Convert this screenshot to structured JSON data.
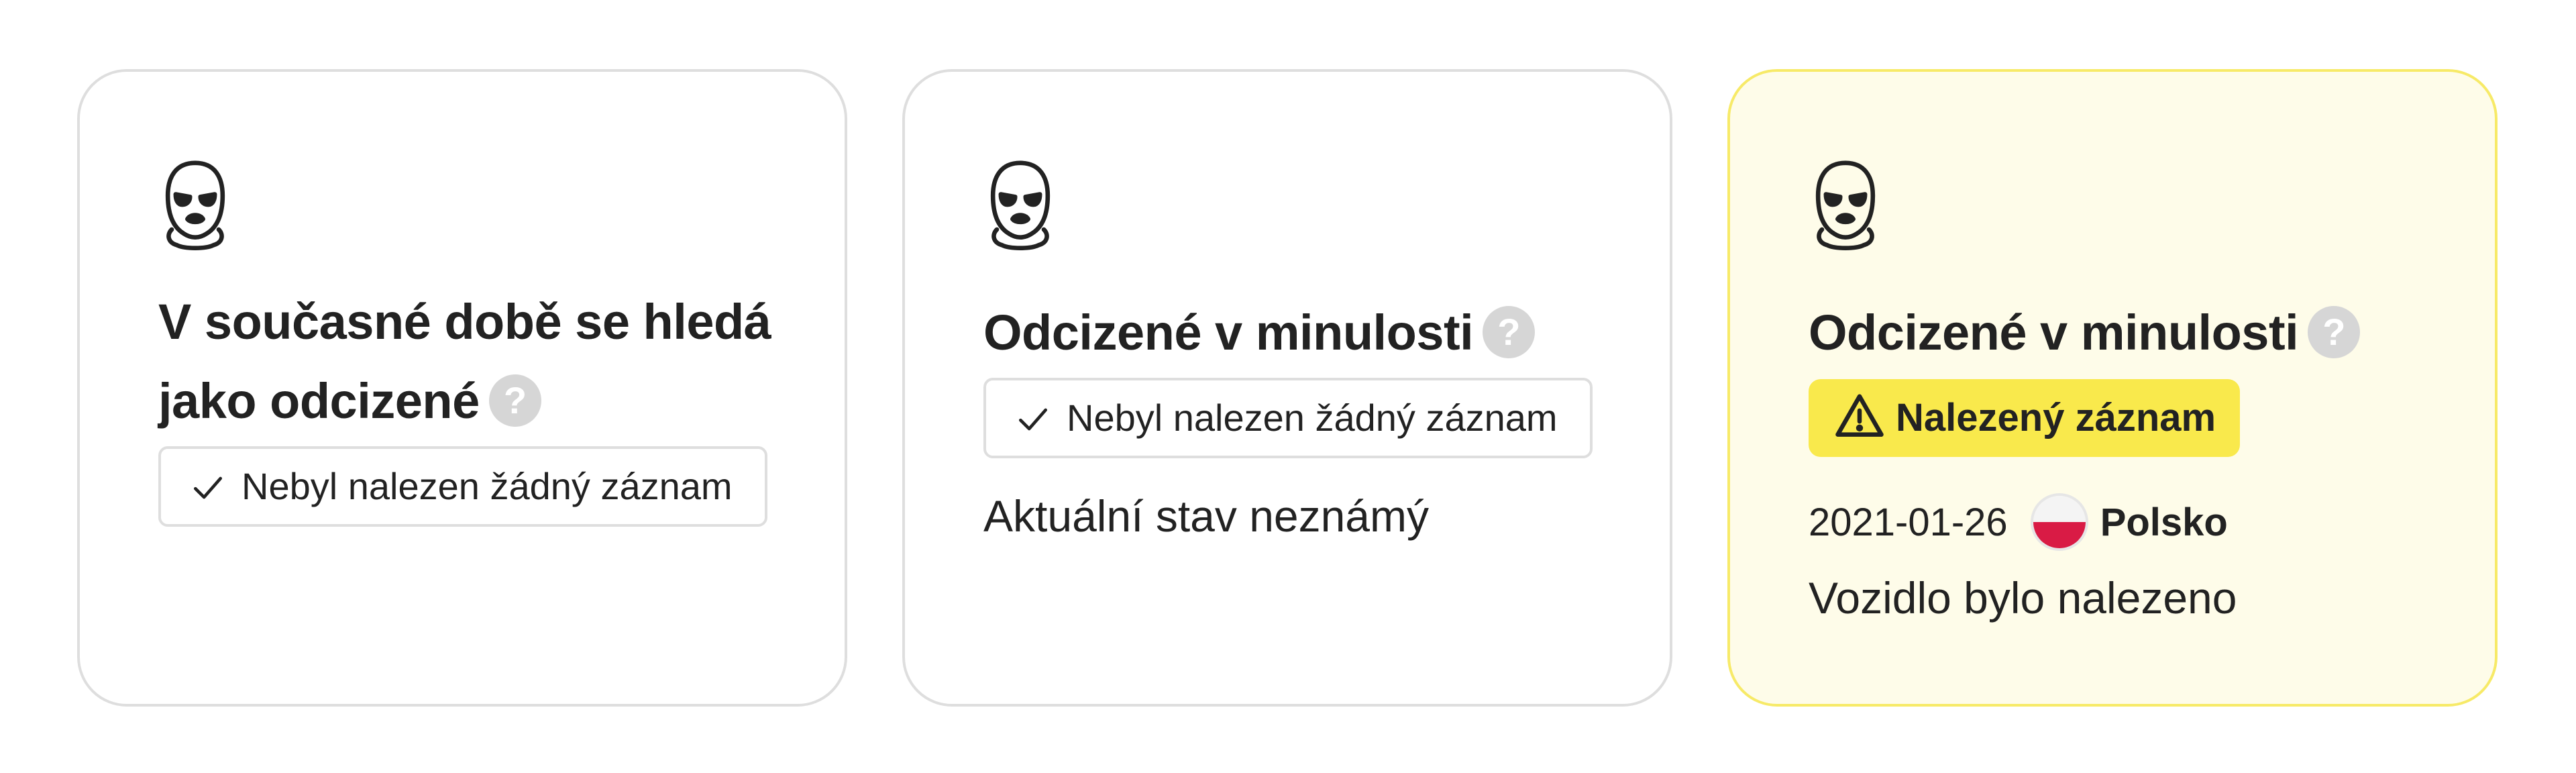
{
  "cards": [
    {
      "icon": "balaclava-mask-icon",
      "title": "V současné době se hledá jako odcizené",
      "help": "?",
      "record": "Nebyl nalezen žádný záznam"
    },
    {
      "icon": "balaclava-mask-icon",
      "title": "Odcizené v minulosti",
      "help": "?",
      "record": "Nebyl nalezen žádný záznam",
      "status": "Aktuální stav neznámý"
    },
    {
      "icon": "balaclava-mask-icon",
      "title": "Odcizené v minulosti",
      "help": "?",
      "badge": "Nalezený záznam",
      "date": "2021-01-26",
      "country": "Polsko",
      "note": "Vozidlo bylo nalezeno"
    }
  ],
  "colors": {
    "border": "#dedede",
    "highlight_bg": "#fefce9",
    "highlight_border": "#f7ea68",
    "badge_bg": "#f9e94c",
    "help_bg": "#d6d6d6",
    "flag_red": "#d91b45"
  },
  "icons": [
    "balaclava-mask-icon",
    "help-icon",
    "check-icon",
    "warning-icon",
    "poland-flag-icon"
  ]
}
